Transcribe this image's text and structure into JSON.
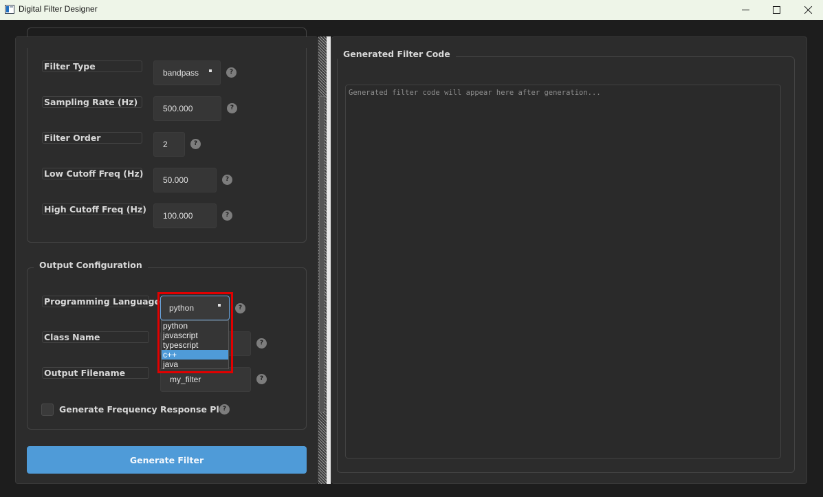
{
  "window": {
    "title": "Digital Filter Designer"
  },
  "filter_params": {
    "type_label": "Filter Type",
    "type_value": "bandpass",
    "sampling_label": "Sampling Rate (Hz)",
    "sampling_value": "500.000",
    "order_label": "Filter Order",
    "order_value": "2",
    "low_cutoff_label": "Low Cutoff Freq (Hz)",
    "low_cutoff_value": "50.000",
    "high_cutoff_label": "High Cutoff Freq (Hz)",
    "high_cutoff_value": "100.000"
  },
  "output_config": {
    "group_title": "Output Configuration",
    "language_label": "Programming Language",
    "language_value": "python",
    "language_options": [
      "python",
      "javascript",
      "typescript",
      "c++",
      "java"
    ],
    "language_highlighted": "c++",
    "class_name_label": "Class Name",
    "filename_label": "Output Filename",
    "filename_value": "my_filter",
    "plot_checkbox_label": "Generate Frequency Response Plot",
    "plot_checked": false
  },
  "help_icon_text": "?",
  "generate_button": "Generate Filter",
  "code_panel": {
    "title": "Generated Filter Code",
    "placeholder": "Generated filter code will appear here after generation..."
  },
  "colors": {
    "accent": "#4f9bd8",
    "highlight_box": "#e00000"
  }
}
